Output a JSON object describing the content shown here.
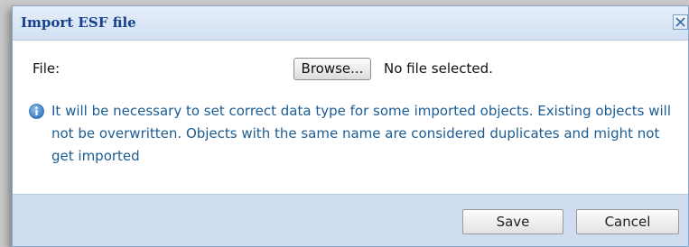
{
  "dialog": {
    "title": "Import ESF file",
    "close_icon": "close-icon"
  },
  "form": {
    "file_label": "File:",
    "browse_label": "Browse...",
    "file_status": "No file selected."
  },
  "info": {
    "icon": "info-icon",
    "message": "It will be necessary to set correct data type for some imported objects. Existing objects will not be overwritten. Objects with the same name are considered duplicates and might not get imported"
  },
  "footer": {
    "save_label": "Save",
    "cancel_label": "Cancel"
  },
  "colors": {
    "title_text": "#15428b",
    "info_text": "#1b5c93",
    "footer_bg": "#d0ddf0"
  }
}
